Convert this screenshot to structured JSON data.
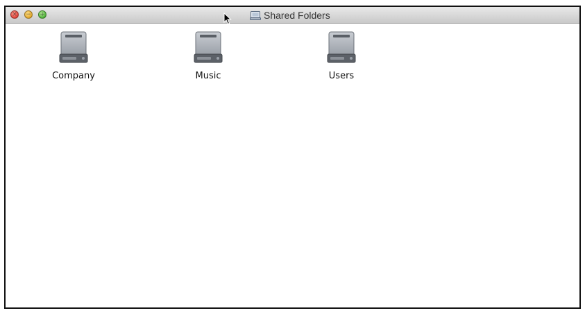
{
  "window": {
    "title": "Shared Folders",
    "title_icon": "volume-icon",
    "buttons": {
      "close": {
        "icon": "close-icon",
        "glyph": "×",
        "color": "#e0443a"
      },
      "minimize": {
        "icon": "minimize-icon",
        "glyph": "−",
        "color": "#e3a82a"
      },
      "zoom": {
        "icon": "zoom-icon",
        "glyph": "+",
        "color": "#4fb13a"
      }
    }
  },
  "items": [
    {
      "label": "Company",
      "icon": "hard-drive-icon"
    },
    {
      "label": "Music",
      "icon": "hard-drive-icon"
    },
    {
      "label": "Users",
      "icon": "hard-drive-icon"
    }
  ]
}
